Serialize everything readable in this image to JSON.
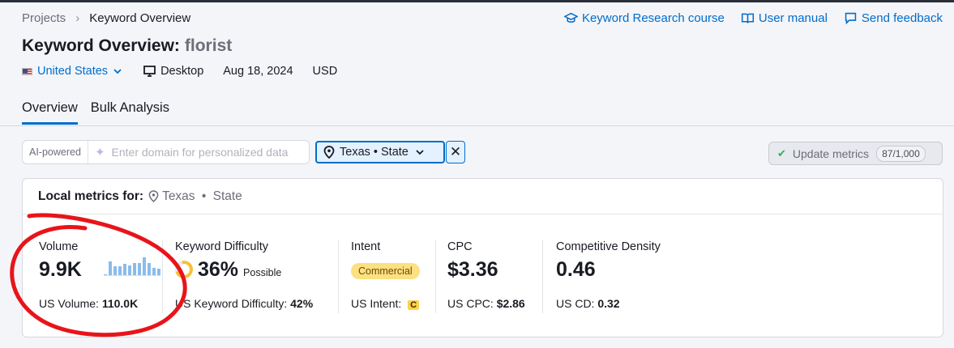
{
  "breadcrumb": {
    "root": "Projects",
    "current": "Keyword Overview"
  },
  "links": {
    "course": "Keyword Research course",
    "manual": "User manual",
    "feedback": "Send feedback"
  },
  "title": {
    "prefix": "Keyword Overview:",
    "keyword": "florist"
  },
  "meta": {
    "country": "United States",
    "device": "Desktop",
    "date": "Aug 18, 2024",
    "currency": "USD"
  },
  "tabs": [
    {
      "label": "Overview",
      "active": true
    },
    {
      "label": "Bulk Analysis",
      "active": false
    }
  ],
  "filters": {
    "ai_label": "AI-powered",
    "ai_placeholder": "Enter domain for personalized data",
    "location": "Texas • State",
    "update_label": "Update metrics",
    "update_count": "87/1,000"
  },
  "card": {
    "header_label": "Local metrics for:",
    "header_location": "Texas",
    "header_scope": "State",
    "volume": {
      "label": "Volume",
      "value": "9.9K",
      "sub_label": "US Volume:",
      "sub_value": "110.0K",
      "trend": [
        0.05,
        0.75,
        0.5,
        0.5,
        0.65,
        0.55,
        0.7,
        0.7,
        1.0,
        0.7,
        0.4,
        0.35
      ]
    },
    "kd": {
      "label": "Keyword Difficulty",
      "value": "36%",
      "rating": "Possible",
      "sub_label": "US Keyword Difficulty:",
      "sub_value": "42%"
    },
    "intent": {
      "label": "Intent",
      "badge": "Commercial",
      "sub_label": "US Intent:",
      "sub_badge": "C"
    },
    "cpc": {
      "label": "CPC",
      "value": "$3.36",
      "sub_label": "US CPC:",
      "sub_value": "$2.86"
    },
    "density": {
      "label": "Competitive Density",
      "value": "0.46",
      "sub_label": "US CD:",
      "sub_value": "0.32"
    }
  },
  "colors": {
    "accent": "#006dca",
    "annotation": "#e8141a",
    "intent_badge": "#fce081"
  }
}
